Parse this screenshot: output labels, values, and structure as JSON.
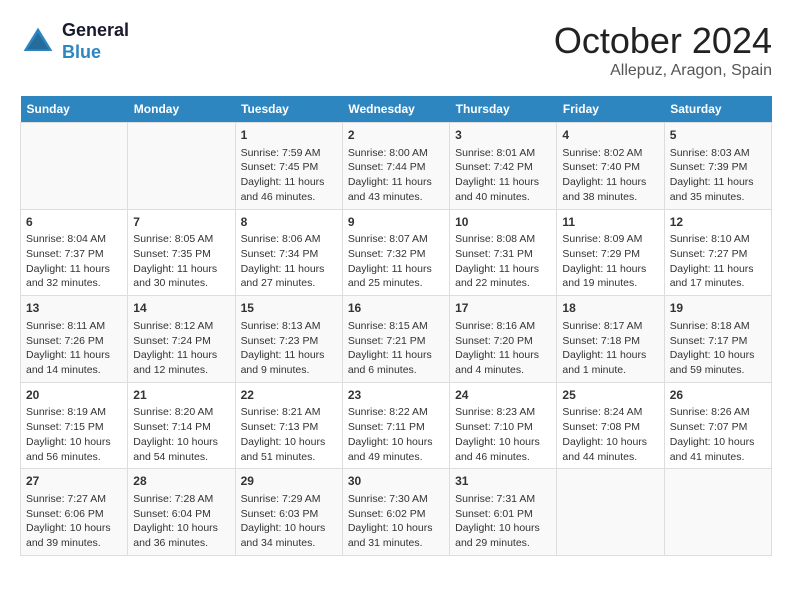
{
  "header": {
    "logo_line1": "General",
    "logo_line2": "Blue",
    "month": "October 2024",
    "location": "Allepuz, Aragon, Spain"
  },
  "weekdays": [
    "Sunday",
    "Monday",
    "Tuesday",
    "Wednesday",
    "Thursday",
    "Friday",
    "Saturday"
  ],
  "weeks": [
    [
      {
        "day": "",
        "info": ""
      },
      {
        "day": "",
        "info": ""
      },
      {
        "day": "1",
        "info": "Sunrise: 7:59 AM\nSunset: 7:45 PM\nDaylight: 11 hours and 46 minutes."
      },
      {
        "day": "2",
        "info": "Sunrise: 8:00 AM\nSunset: 7:44 PM\nDaylight: 11 hours and 43 minutes."
      },
      {
        "day": "3",
        "info": "Sunrise: 8:01 AM\nSunset: 7:42 PM\nDaylight: 11 hours and 40 minutes."
      },
      {
        "day": "4",
        "info": "Sunrise: 8:02 AM\nSunset: 7:40 PM\nDaylight: 11 hours and 38 minutes."
      },
      {
        "day": "5",
        "info": "Sunrise: 8:03 AM\nSunset: 7:39 PM\nDaylight: 11 hours and 35 minutes."
      }
    ],
    [
      {
        "day": "6",
        "info": "Sunrise: 8:04 AM\nSunset: 7:37 PM\nDaylight: 11 hours and 32 minutes."
      },
      {
        "day": "7",
        "info": "Sunrise: 8:05 AM\nSunset: 7:35 PM\nDaylight: 11 hours and 30 minutes."
      },
      {
        "day": "8",
        "info": "Sunrise: 8:06 AM\nSunset: 7:34 PM\nDaylight: 11 hours and 27 minutes."
      },
      {
        "day": "9",
        "info": "Sunrise: 8:07 AM\nSunset: 7:32 PM\nDaylight: 11 hours and 25 minutes."
      },
      {
        "day": "10",
        "info": "Sunrise: 8:08 AM\nSunset: 7:31 PM\nDaylight: 11 hours and 22 minutes."
      },
      {
        "day": "11",
        "info": "Sunrise: 8:09 AM\nSunset: 7:29 PM\nDaylight: 11 hours and 19 minutes."
      },
      {
        "day": "12",
        "info": "Sunrise: 8:10 AM\nSunset: 7:27 PM\nDaylight: 11 hours and 17 minutes."
      }
    ],
    [
      {
        "day": "13",
        "info": "Sunrise: 8:11 AM\nSunset: 7:26 PM\nDaylight: 11 hours and 14 minutes."
      },
      {
        "day": "14",
        "info": "Sunrise: 8:12 AM\nSunset: 7:24 PM\nDaylight: 11 hours and 12 minutes."
      },
      {
        "day": "15",
        "info": "Sunrise: 8:13 AM\nSunset: 7:23 PM\nDaylight: 11 hours and 9 minutes."
      },
      {
        "day": "16",
        "info": "Sunrise: 8:15 AM\nSunset: 7:21 PM\nDaylight: 11 hours and 6 minutes."
      },
      {
        "day": "17",
        "info": "Sunrise: 8:16 AM\nSunset: 7:20 PM\nDaylight: 11 hours and 4 minutes."
      },
      {
        "day": "18",
        "info": "Sunrise: 8:17 AM\nSunset: 7:18 PM\nDaylight: 11 hours and 1 minute."
      },
      {
        "day": "19",
        "info": "Sunrise: 8:18 AM\nSunset: 7:17 PM\nDaylight: 10 hours and 59 minutes."
      }
    ],
    [
      {
        "day": "20",
        "info": "Sunrise: 8:19 AM\nSunset: 7:15 PM\nDaylight: 10 hours and 56 minutes."
      },
      {
        "day": "21",
        "info": "Sunrise: 8:20 AM\nSunset: 7:14 PM\nDaylight: 10 hours and 54 minutes."
      },
      {
        "day": "22",
        "info": "Sunrise: 8:21 AM\nSunset: 7:13 PM\nDaylight: 10 hours and 51 minutes."
      },
      {
        "day": "23",
        "info": "Sunrise: 8:22 AM\nSunset: 7:11 PM\nDaylight: 10 hours and 49 minutes."
      },
      {
        "day": "24",
        "info": "Sunrise: 8:23 AM\nSunset: 7:10 PM\nDaylight: 10 hours and 46 minutes."
      },
      {
        "day": "25",
        "info": "Sunrise: 8:24 AM\nSunset: 7:08 PM\nDaylight: 10 hours and 44 minutes."
      },
      {
        "day": "26",
        "info": "Sunrise: 8:26 AM\nSunset: 7:07 PM\nDaylight: 10 hours and 41 minutes."
      }
    ],
    [
      {
        "day": "27",
        "info": "Sunrise: 7:27 AM\nSunset: 6:06 PM\nDaylight: 10 hours and 39 minutes."
      },
      {
        "day": "28",
        "info": "Sunrise: 7:28 AM\nSunset: 6:04 PM\nDaylight: 10 hours and 36 minutes."
      },
      {
        "day": "29",
        "info": "Sunrise: 7:29 AM\nSunset: 6:03 PM\nDaylight: 10 hours and 34 minutes."
      },
      {
        "day": "30",
        "info": "Sunrise: 7:30 AM\nSunset: 6:02 PM\nDaylight: 10 hours and 31 minutes."
      },
      {
        "day": "31",
        "info": "Sunrise: 7:31 AM\nSunset: 6:01 PM\nDaylight: 10 hours and 29 minutes."
      },
      {
        "day": "",
        "info": ""
      },
      {
        "day": "",
        "info": ""
      }
    ]
  ]
}
